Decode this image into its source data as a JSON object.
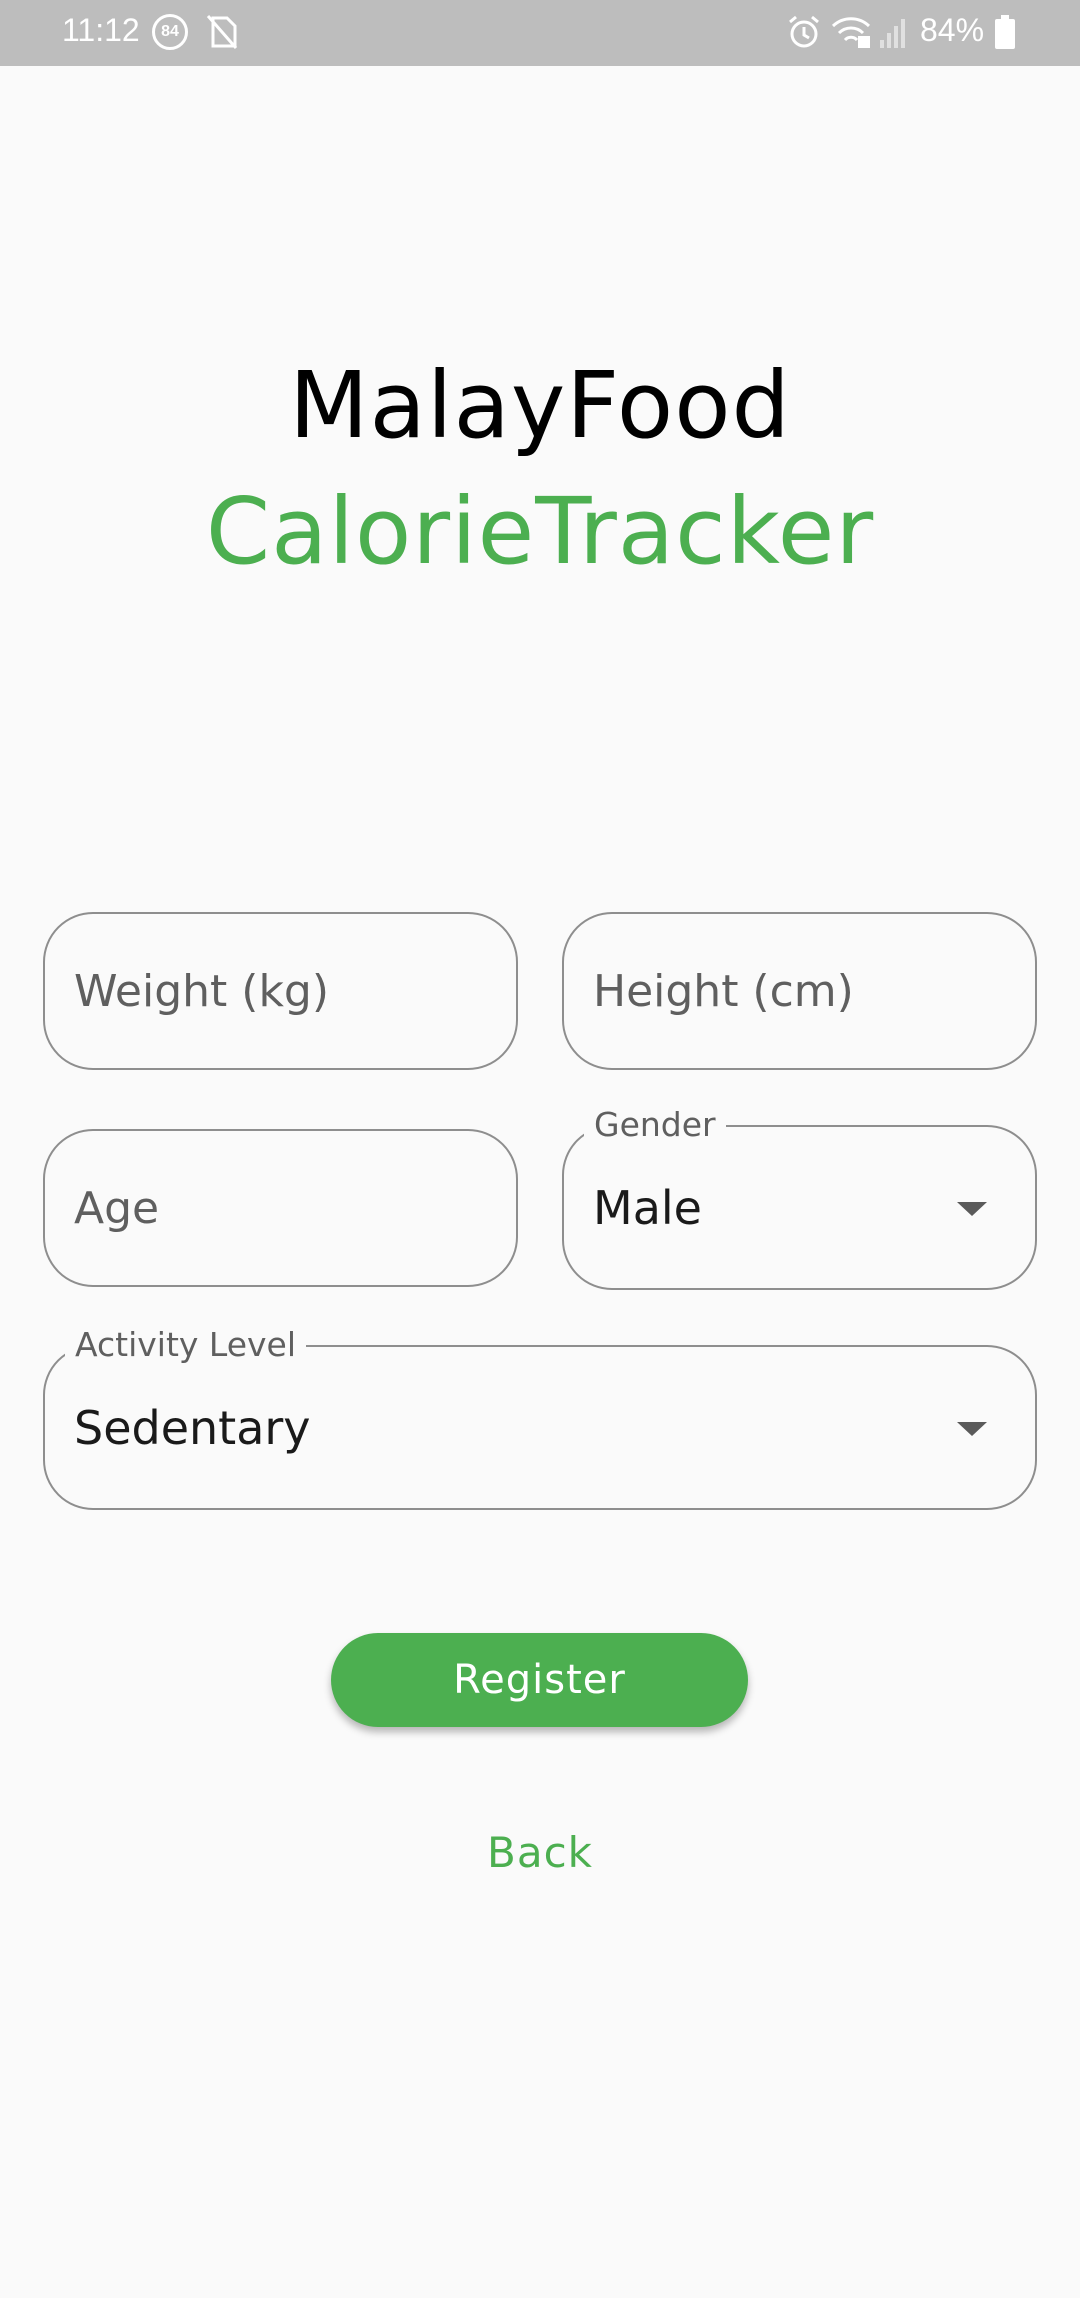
{
  "status_bar": {
    "time": "11:12",
    "notification_badge": "84",
    "battery_percent": "84%",
    "icons": [
      "alarm-icon",
      "wifi-icon",
      "signal-icon",
      "battery-icon",
      "no-sim-icon"
    ]
  },
  "header": {
    "title_line1": "MalayFood",
    "title_line2": "CalorieTracker"
  },
  "form": {
    "weight_placeholder": "Weight (kg)",
    "height_placeholder": "Height (cm)",
    "age_placeholder": "Age",
    "gender_label": "Gender",
    "gender_value": "Male",
    "activity_label": "Activity Level",
    "activity_value": "Sedentary"
  },
  "actions": {
    "register_label": "Register",
    "back_label": "Back"
  },
  "colors": {
    "accent": "#4caf50",
    "status_bar": "#bdbdbd",
    "background": "#fafafa",
    "border": "#8e8e8e"
  }
}
